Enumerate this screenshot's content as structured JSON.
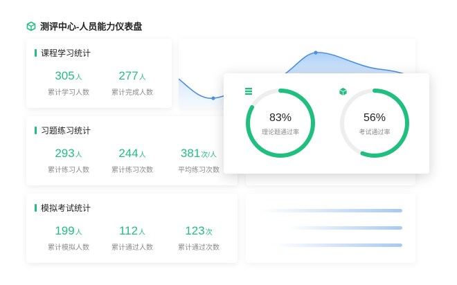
{
  "header": {
    "title": "测评中心-人员能力仪表盘"
  },
  "course": {
    "title": "课程学习统计",
    "stats": [
      {
        "value": "305",
        "unit": "人",
        "label": "累计学习人数"
      },
      {
        "value": "277",
        "unit": "人",
        "label": "累计完成人数"
      }
    ]
  },
  "exercise": {
    "title": "习题练习统计",
    "stats": [
      {
        "value": "293",
        "unit": "人",
        "label": "累计练习人数"
      },
      {
        "value": "244",
        "unit": "人",
        "label": "累计练习次数"
      },
      {
        "value": "381",
        "unit": "次/人",
        "label": "平均练习次数"
      }
    ]
  },
  "exam": {
    "title": "模拟考试统计",
    "stats": [
      {
        "value": "199",
        "unit": "人",
        "label": "累计模拟人数"
      },
      {
        "value": "112",
        "unit": "人",
        "label": "累计通过人数"
      },
      {
        "value": "123",
        "unit": "次",
        "label": "累计通过次数"
      }
    ]
  },
  "gauges": [
    {
      "percent": "83%",
      "label": "理论题通过率",
      "fraction": 0.83,
      "icon": "document-stack-icon"
    },
    {
      "percent": "56%",
      "label": "考试通过率",
      "fraction": 0.56,
      "icon": "cube-icon"
    }
  ],
  "colors": {
    "accent": "#1fbf7f",
    "chart_blue": "#4a90e2",
    "chart_fill": "#b9d6f7",
    "track": "#eeeeee"
  }
}
